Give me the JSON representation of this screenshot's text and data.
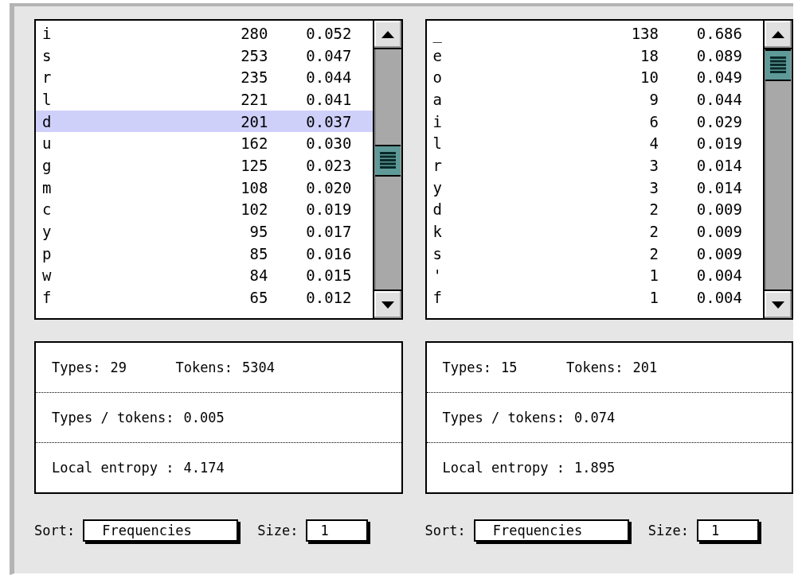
{
  "panels": [
    {
      "rows": [
        {
          "symbol": "i",
          "count": "280",
          "share": "0.052",
          "selected": false
        },
        {
          "symbol": "s",
          "count": "253",
          "share": "0.047",
          "selected": false
        },
        {
          "symbol": "r",
          "count": "235",
          "share": "0.044",
          "selected": false
        },
        {
          "symbol": "l",
          "count": "221",
          "share": "0.041",
          "selected": false
        },
        {
          "symbol": "d",
          "count": "201",
          "share": "0.037",
          "selected": true
        },
        {
          "symbol": "u",
          "count": "162",
          "share": "0.030",
          "selected": false
        },
        {
          "symbol": "g",
          "count": "125",
          "share": "0.023",
          "selected": false
        },
        {
          "symbol": "m",
          "count": "108",
          "share": "0.020",
          "selected": false
        },
        {
          "symbol": "c",
          "count": "102",
          "share": "0.019",
          "selected": false
        },
        {
          "symbol": "y",
          "count": "95",
          "share": "0.017",
          "selected": false
        },
        {
          "symbol": "p",
          "count": "85",
          "share": "0.016",
          "selected": false
        },
        {
          "symbol": "w",
          "count": "84",
          "share": "0.015",
          "selected": false
        },
        {
          "symbol": "f",
          "count": "65",
          "share": "0.012",
          "selected": false
        }
      ],
      "stats": {
        "types_label": "Types:",
        "types": "29",
        "tokens_label": "Tokens:",
        "tokens": "5304",
        "ratio_label": "Types / tokens:",
        "ratio": "0.005",
        "entropy_label": "Local entropy :",
        "entropy": "4.174"
      },
      "sort": {
        "label": "Sort:",
        "value": "Frequencies"
      },
      "size": {
        "label": "Size:",
        "value": "1"
      }
    },
    {
      "rows": [
        {
          "symbol": "_",
          "count": "138",
          "share": "0.686",
          "selected": false
        },
        {
          "symbol": "e",
          "count": "18",
          "share": "0.089",
          "selected": false
        },
        {
          "symbol": "o",
          "count": "10",
          "share": "0.049",
          "selected": false
        },
        {
          "symbol": "a",
          "count": "9",
          "share": "0.044",
          "selected": false
        },
        {
          "symbol": "i",
          "count": "6",
          "share": "0.029",
          "selected": false
        },
        {
          "symbol": "l",
          "count": "4",
          "share": "0.019",
          "selected": false
        },
        {
          "symbol": "r",
          "count": "3",
          "share": "0.014",
          "selected": false
        },
        {
          "symbol": "y",
          "count": "3",
          "share": "0.014",
          "selected": false
        },
        {
          "symbol": "d",
          "count": "2",
          "share": "0.009",
          "selected": false
        },
        {
          "symbol": "k",
          "count": "2",
          "share": "0.009",
          "selected": false
        },
        {
          "symbol": "s",
          "count": "2",
          "share": "0.009",
          "selected": false
        },
        {
          "symbol": "'",
          "count": "1",
          "share": "0.004",
          "selected": false
        },
        {
          "symbol": "f",
          "count": "1",
          "share": "0.004",
          "selected": false
        }
      ],
      "stats": {
        "types_label": "Types:",
        "types": "15",
        "tokens_label": "Tokens:",
        "tokens": "201",
        "ratio_label": "Types / tokens:",
        "ratio": "0.074",
        "entropy_label": "Local entropy :",
        "entropy": "1.895"
      },
      "sort": {
        "label": "Sort:",
        "value": "Frequencies"
      },
      "size": {
        "label": "Size:",
        "value": "1"
      }
    }
  ]
}
